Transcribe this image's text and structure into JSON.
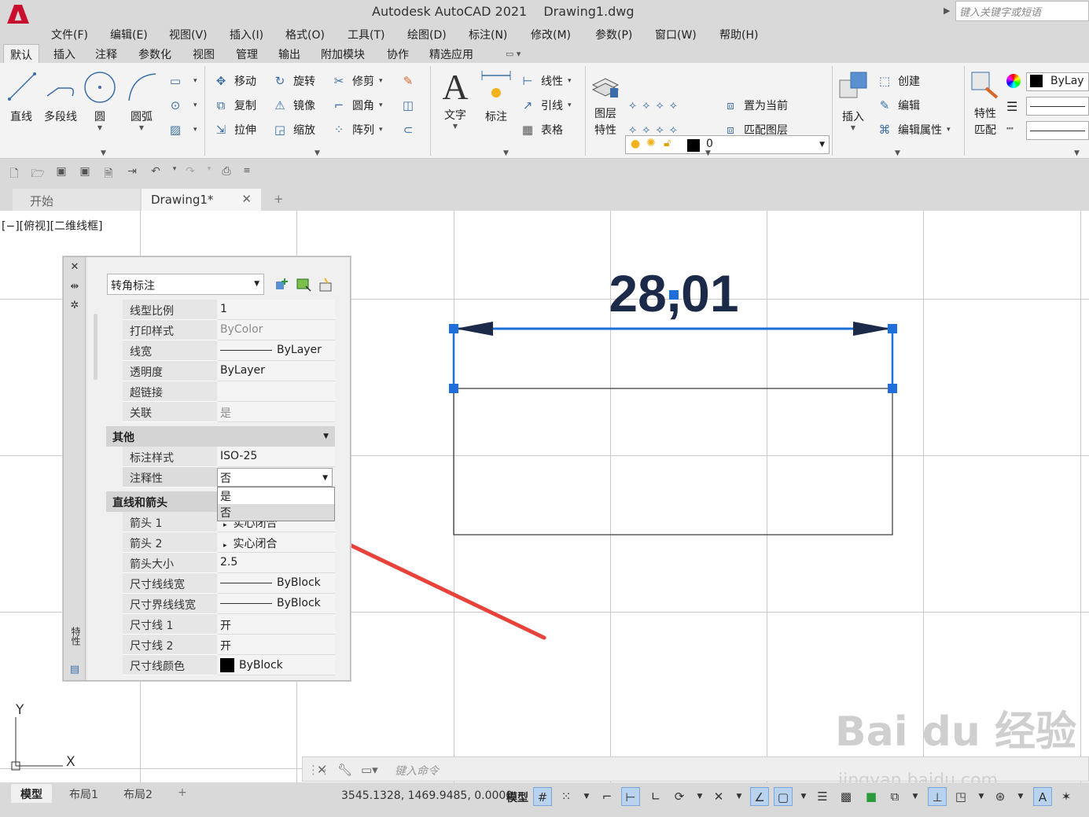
{
  "app": {
    "logo_letter": "A",
    "title": "Autodesk AutoCAD 2021",
    "file": "Drawing1.dwg",
    "search_placeholder": "键入关键字或短语"
  },
  "menu": [
    "文件(F)",
    "编辑(E)",
    "视图(V)",
    "插入(I)",
    "格式(O)",
    "工具(T)",
    "绘图(D)",
    "标注(N)",
    "修改(M)",
    "参数(P)",
    "窗口(W)",
    "帮助(H)"
  ],
  "ribbon_tabs": [
    "默认",
    "插入",
    "注释",
    "参数化",
    "视图",
    "管理",
    "输出",
    "附加模块",
    "协作",
    "精选应用"
  ],
  "ribbon": {
    "draw": {
      "line": "直线",
      "polyline": "多段线",
      "circle": "圆",
      "arc": "圆弧"
    },
    "modify": {
      "move": "移动",
      "rotate": "旋转",
      "trim": "修剪",
      "copy": "复制",
      "mirror": "镜像",
      "fillet": "圆角",
      "stretch": "拉伸",
      "scale": "缩放",
      "array": "阵列"
    },
    "annotation": {
      "text": "文字",
      "dimension": "标注",
      "linear": "线性",
      "leader": "引线",
      "table": "表格"
    },
    "layers": {
      "props_line1": "图层",
      "props_line2": "特性",
      "current_layer": "0",
      "set_current": "置为当前",
      "match_layer": "匹配图层"
    },
    "block": {
      "insert": "插入",
      "create": "创建",
      "edit": "编辑",
      "edit_attr": "编辑属性"
    },
    "properties": {
      "match_line1": "特性",
      "match_line2": "匹配",
      "bylayer": "ByLay"
    }
  },
  "doc_tabs": {
    "start": "开始",
    "drawing": "Drawing1*"
  },
  "viewport_label": "[−][俯视][二维线框]",
  "drawing": {
    "dimension_text": "28,01"
  },
  "palette": {
    "side_title": "特性",
    "object_type": "转角标注",
    "rows_top": [
      {
        "name": "线型比例",
        "value": "1"
      },
      {
        "name": "打印样式",
        "value": "ByColor",
        "gray": true
      },
      {
        "name": "线宽",
        "value": "ByLayer",
        "line": true
      },
      {
        "name": "透明度",
        "value": "ByLayer"
      },
      {
        "name": "超链接",
        "value": ""
      },
      {
        "name": "关联",
        "value": "是",
        "gray": true
      }
    ],
    "section_other": "其他",
    "dim_style_label": "标注样式",
    "dim_style_value": "ISO-25",
    "annotative_label": "注释性",
    "annotative_value": "否",
    "dropdown_options": [
      "是",
      "否"
    ],
    "section_lines": "直线和箭头",
    "rows_lines": [
      {
        "name": "箭头 1",
        "value": "实心闭合",
        "arrow": true
      },
      {
        "name": "箭头 2",
        "value": "实心闭合",
        "arrow": true
      },
      {
        "name": "箭头大小",
        "value": "2.5"
      },
      {
        "name": "尺寸线线宽",
        "value": "ByBlock",
        "line": true
      },
      {
        "name": "尺寸界线线宽",
        "value": "ByBlock",
        "line": true
      },
      {
        "name": "尺寸线 1",
        "value": "开"
      },
      {
        "name": "尺寸线 2",
        "value": "开"
      },
      {
        "name": "尺寸线颜色",
        "value": "ByBlock",
        "swatch": true
      }
    ]
  },
  "command_line": {
    "placeholder": "键入命令"
  },
  "layout_tabs": [
    "模型",
    "布局1",
    "布局2"
  ],
  "status": {
    "coords": "3545.1328, 1469.9485, 0.0000",
    "model": "模型"
  },
  "ucs": {
    "x": "X",
    "y": "Y"
  },
  "watermark": {
    "main": "Bai du 经验",
    "sub": "jingyan.baidu.com"
  },
  "colors": {
    "selection_blue": "#1e6fd9",
    "dim_navy": "#1c2a4a",
    "arrow_red": "#e8433a"
  }
}
